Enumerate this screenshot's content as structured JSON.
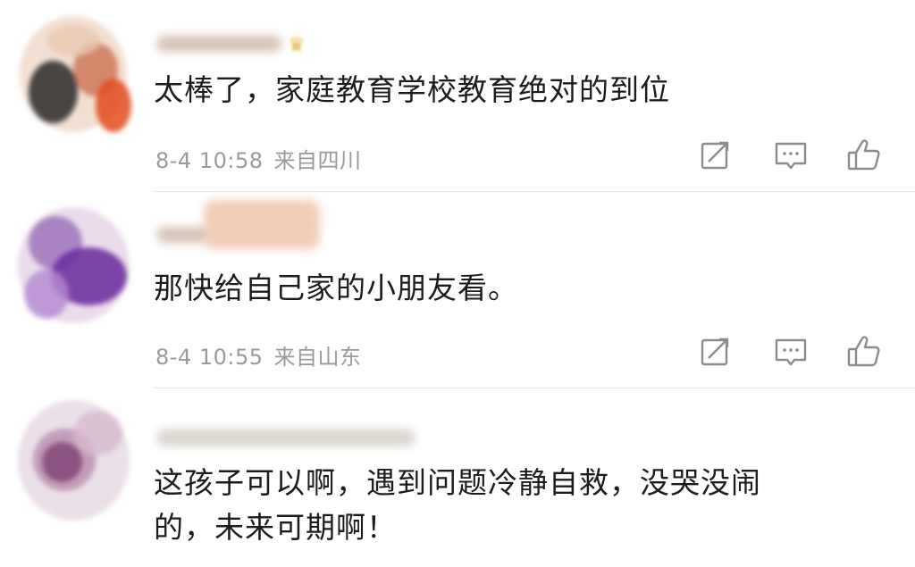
{
  "comments": [
    {
      "text_lines": [
        "太棒了，家庭教育学校教育绝对的到位"
      ],
      "time": "8-4 10:58",
      "location": "来自四川",
      "username_redacted": true,
      "badge_icon": "crown-icon"
    },
    {
      "text_lines": [
        "那快给自己家的小朋友看。"
      ],
      "time": "8-4 10:55",
      "location": "来自山东",
      "username_redacted": true
    },
    {
      "text_lines": [
        "这孩子可以啊，遇到问题冷静自救，没哭没闹",
        "的，未来可期啊！"
      ],
      "username_redacted": true
    }
  ],
  "action_icons": [
    "share-icon",
    "comment-icon",
    "like-icon"
  ],
  "colors": {
    "text": "#1c1c1c",
    "meta": "#9a9a9a",
    "divider": "#e6e6e6",
    "icon": "#8c8c8c"
  }
}
